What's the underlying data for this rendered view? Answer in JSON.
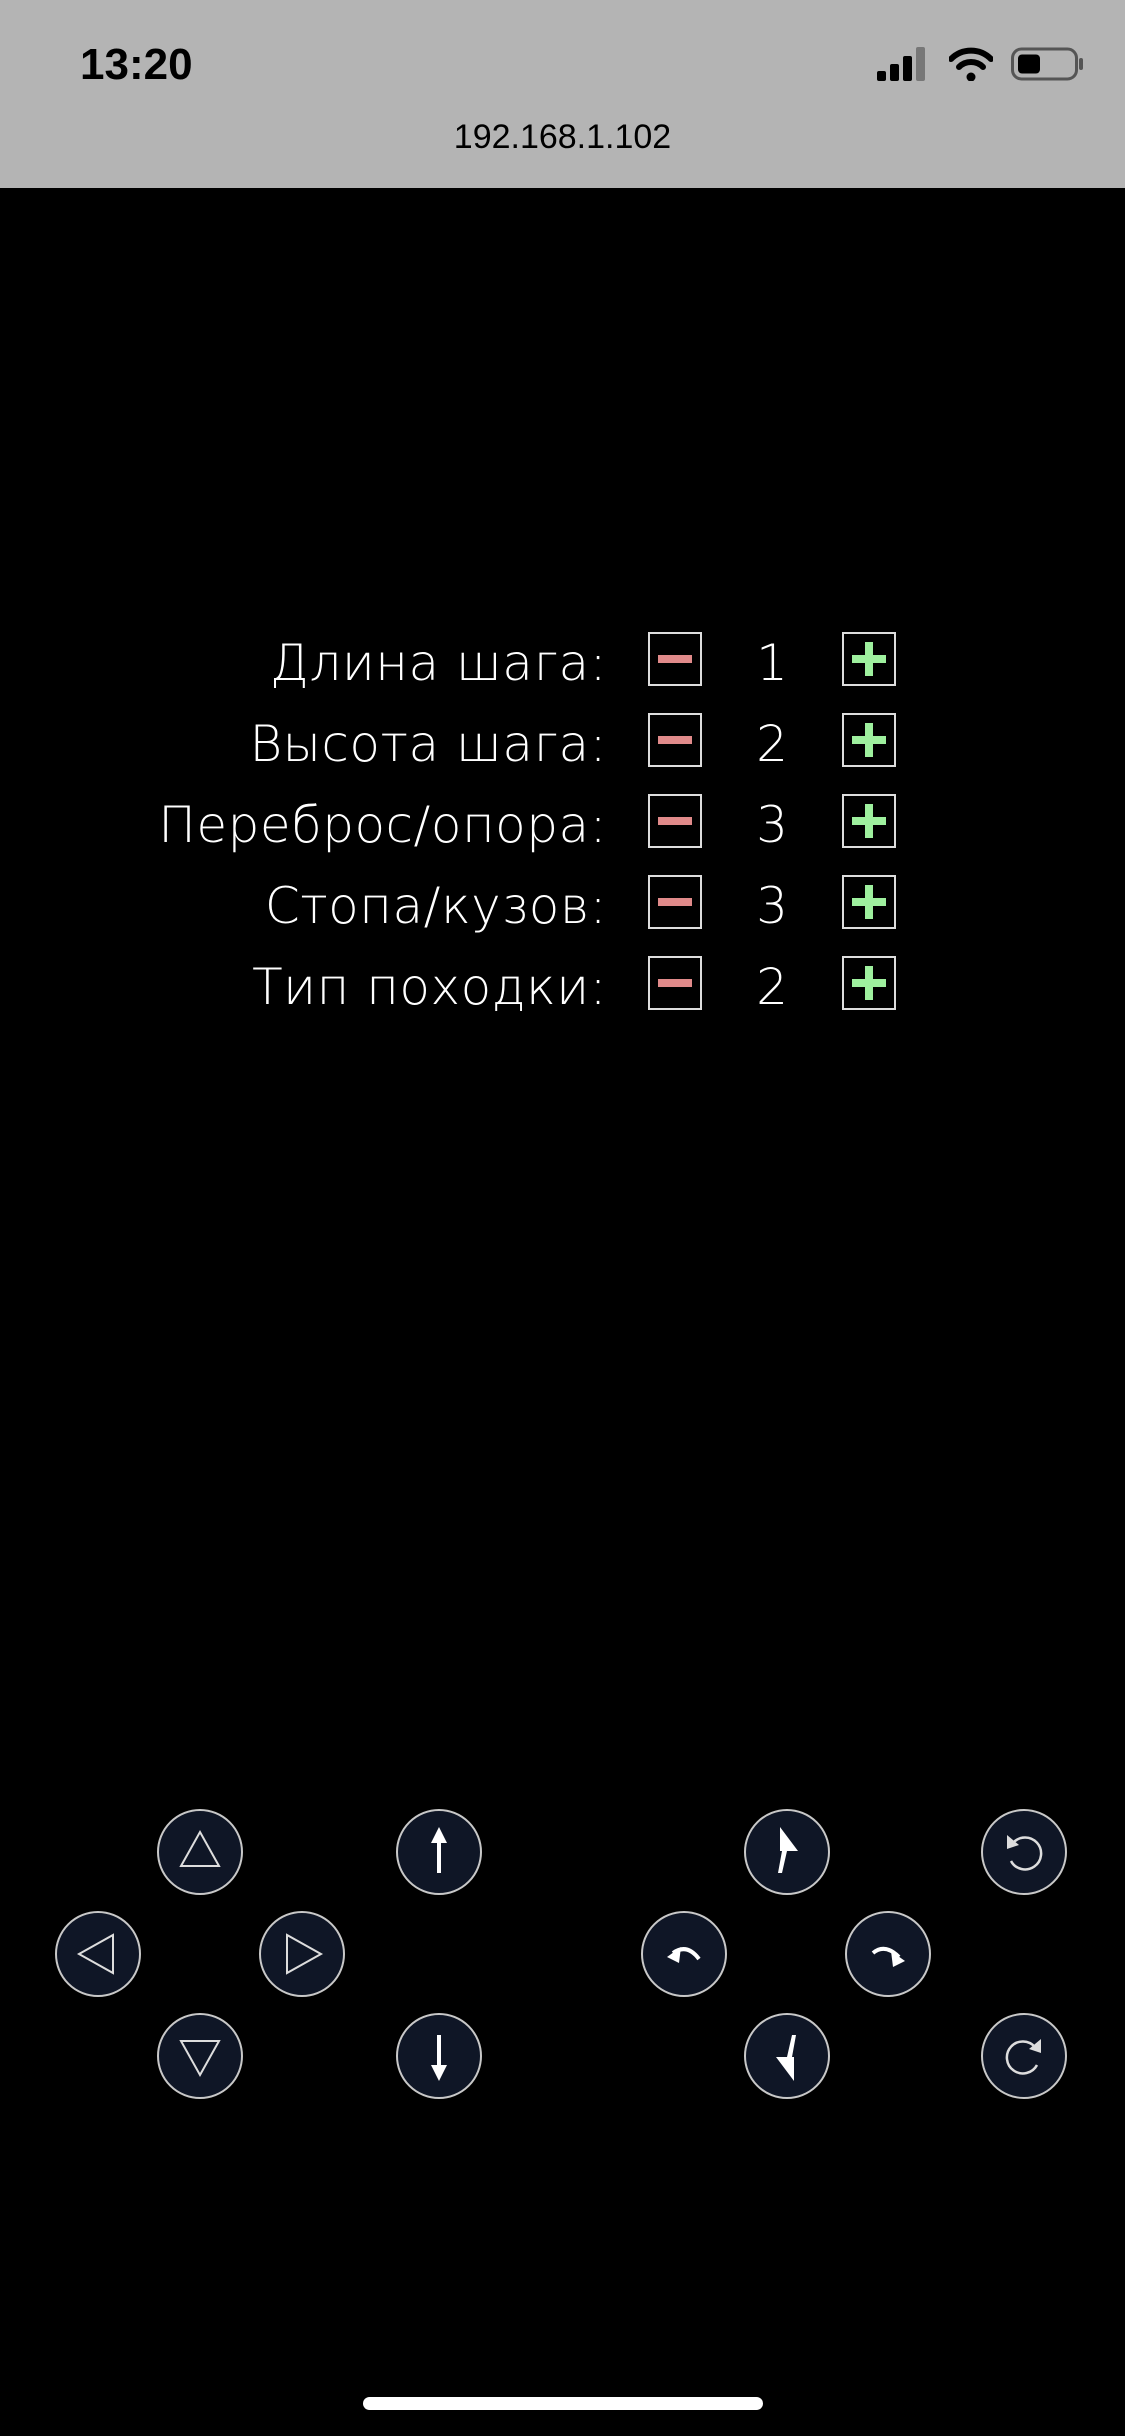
{
  "status_bar": {
    "time": "13:20",
    "url": "192.168.1.102",
    "icons": [
      "signal-icon",
      "wifi-icon",
      "battery-icon"
    ]
  },
  "settings": [
    {
      "label": "Длина шага:",
      "value": "1"
    },
    {
      "label": "Высота шага:",
      "value": "2"
    },
    {
      "label": "Переброс/опора:",
      "value": "3"
    },
    {
      "label": "Стопа/кузов:",
      "value": "3"
    },
    {
      "label": "Тип походки:",
      "value": "2"
    }
  ],
  "colors": {
    "minus": "#e08a8a",
    "plus": "#9ef09e",
    "pad_fill": "#0f1626",
    "status_bar": "#b4b4b4"
  },
  "controls": {
    "left_pad": [
      "triangle-up-icon",
      "triangle-left-icon",
      "triangle-right-icon",
      "triangle-down-icon"
    ],
    "height_pad": [
      "arrow-up-icon",
      "arrow-down-icon"
    ],
    "turn_pad": [
      "turn-up-left-icon",
      "turn-left-icon",
      "turn-right-icon",
      "turn-down-right-icon"
    ],
    "rotate_pad": [
      "rotate-ccw-icon",
      "rotate-cw-icon"
    ]
  }
}
